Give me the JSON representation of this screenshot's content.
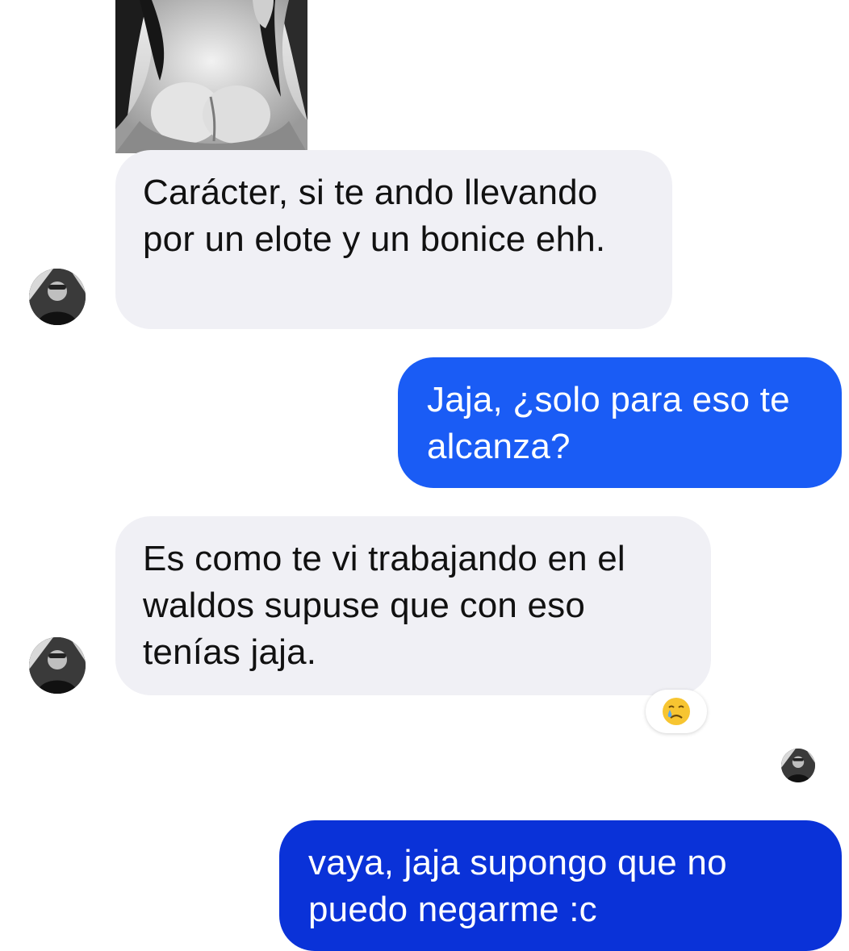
{
  "conversation": {
    "messages": [
      {
        "sender": "contact",
        "text": "Carácter, si te ando llevando por un elote y un bonice ehh."
      },
      {
        "sender": "me",
        "text": "Jaja, ¿solo para eso te alcanza?"
      },
      {
        "sender": "contact",
        "text": "Es como te vi trabajando en el waldos supuse que con eso tenías jaja."
      },
      {
        "sender": "me",
        "text": "vaya, jaja supongo que no puedo negarme :c"
      }
    ],
    "reaction": {
      "emoji": "crying-face-icon"
    }
  },
  "colors": {
    "incoming_bubble": "#f0f0f5",
    "outgoing_bubble_light": "#1a5cf5",
    "outgoing_bubble_dark": "#0a32d8",
    "incoming_text": "#111111",
    "outgoing_text": "#ffffff"
  }
}
